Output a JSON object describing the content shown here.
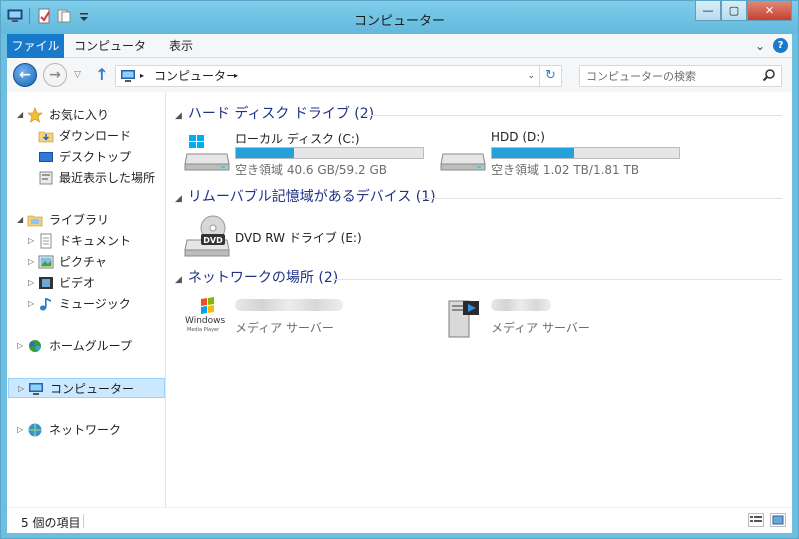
{
  "window": {
    "title": "コンピューター",
    "minimize_label": "—",
    "maximize_label": "▢",
    "close_label": "✕"
  },
  "ribbon": {
    "tabs": [
      {
        "label": "ファイル"
      },
      {
        "label": "コンピューター"
      },
      {
        "label": "表示"
      }
    ],
    "expand_label": "⌄",
    "help_label": "?"
  },
  "address_bar": {
    "back_label": "←",
    "forward_label": "→",
    "history_label": "▽",
    "up_label": "↑",
    "crumb_separator": "▸",
    "crumb": "コンピューター",
    "crumb_separator2": "▸",
    "dropdown_label": "⌄",
    "refresh_label": "↻",
    "search_placeholder": "コンピューターの検索"
  },
  "nav_pane": {
    "favorites": {
      "label": "お気に入り",
      "items": [
        {
          "label": "ダウンロード"
        },
        {
          "label": "デスクトップ"
        },
        {
          "label": "最近表示した場所"
        }
      ]
    },
    "libraries": {
      "label": "ライブラリ",
      "items": [
        {
          "label": "ドキュメント"
        },
        {
          "label": "ピクチャ"
        },
        {
          "label": "ビデオ"
        },
        {
          "label": "ミュージック"
        }
      ]
    },
    "homegroup": {
      "label": "ホームグループ"
    },
    "computer": {
      "label": "コンピューター"
    },
    "network": {
      "label": "ネットワーク"
    },
    "expanded_caret": "◢",
    "collapsed_caret": "▷"
  },
  "groups": {
    "hard_disks": {
      "title": "ハード ディスク ドライブ (2)",
      "caret": "◢",
      "drives": [
        {
          "name": "ローカル ディスク (C:)",
          "free": "空き領域 40.6 GB/59.2 GB",
          "used_fraction": 0.31
        },
        {
          "name": "HDD (D:)",
          "free": "空き領域 1.02 TB/1.81 TB",
          "used_fraction": 0.44
        }
      ]
    },
    "removable": {
      "title": "リムーバブル記憶域があるデバイス (1)",
      "caret": "◢",
      "devices": [
        {
          "name": "DVD RW ドライブ (E:)",
          "icon_text": "DVD"
        }
      ]
    },
    "network_locations": {
      "title": "ネットワークの場所 (2)",
      "caret": "◢",
      "servers": [
        {
          "type": "メディア サーバー",
          "logo_line1": "Windows",
          "logo_line2": "Media Player"
        },
        {
          "type": "メディア サーバー"
        }
      ]
    }
  },
  "status_bar": {
    "item_count": "5 個の項目"
  },
  "colors": {
    "accent": "#1979ca",
    "group_title": "#1e3287",
    "drive_bar": "#26a0da",
    "title_bar": "#6dbfe0",
    "selection": "#cce8ff"
  }
}
